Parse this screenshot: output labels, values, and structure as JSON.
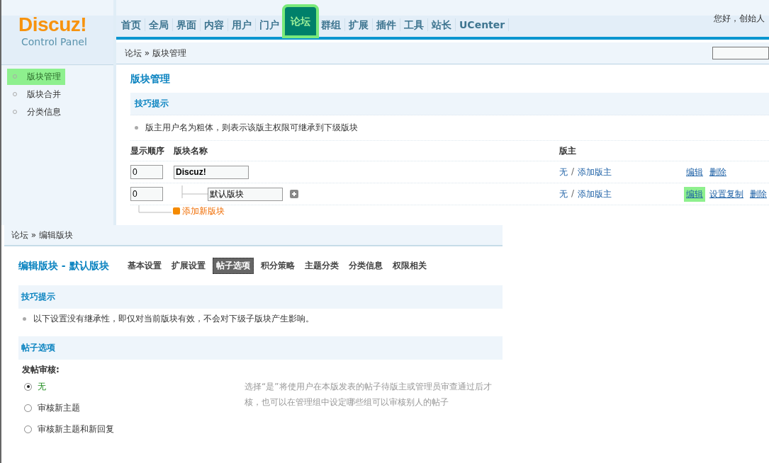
{
  "header": {
    "logo": "Discuz!",
    "subtitle": "Control Panel",
    "greeting": "您好，创始人"
  },
  "nav": [
    {
      "label": "首页",
      "selected": false
    },
    {
      "label": "全局",
      "selected": false
    },
    {
      "label": "界面",
      "selected": false
    },
    {
      "label": "内容",
      "selected": false
    },
    {
      "label": "用户",
      "selected": false
    },
    {
      "label": "门户",
      "selected": false
    },
    {
      "label": "论坛",
      "selected": true
    },
    {
      "label": "群组",
      "selected": false
    },
    {
      "label": "扩展",
      "selected": false
    },
    {
      "label": "插件",
      "selected": false
    },
    {
      "label": "工具",
      "selected": false
    },
    {
      "label": "站长",
      "selected": false
    },
    {
      "label": "UCenter",
      "selected": false
    }
  ],
  "breadcrumb": {
    "items": [
      "论坛",
      "版块管理"
    ],
    "separator": "»"
  },
  "sidebar": [
    {
      "label": "版块管理",
      "selected": true
    },
    {
      "label": "版块合并",
      "selected": false
    },
    {
      "label": "分类信息",
      "selected": false
    }
  ],
  "main": {
    "title": "版块管理",
    "tips": {
      "title": "技巧提示",
      "items": [
        "版主用户名为粗体，则表示该版主权限可继承到下级版块"
      ]
    },
    "table": {
      "columns": [
        "显示顺序",
        "版块名称",
        "版主"
      ],
      "link_separator": "/",
      "rows": [
        {
          "kind": "group",
          "order": "0",
          "name": "Discuz!",
          "moderator_links": [
            "无",
            "添加版主"
          ],
          "actions": [
            {
              "label": "编辑",
              "highlighted": false
            },
            {
              "label": "删除",
              "highlighted": false
            }
          ]
        },
        {
          "kind": "forum",
          "order": "0",
          "name": "默认版块",
          "moderator_links": [
            "无",
            "添加版主"
          ],
          "actions": [
            {
              "label": "编辑",
              "highlighted": true
            },
            {
              "label": "设置复制",
              "highlighted": false
            },
            {
              "label": "删除",
              "highlighted": false
            }
          ]
        }
      ],
      "add_forum": "添加新版块"
    }
  },
  "edit_window": {
    "breadcrumb": {
      "items": [
        "论坛",
        "编辑版块"
      ],
      "separator": "»"
    },
    "title": "编辑版块 - 默认版块",
    "tabs": [
      {
        "label": "基本设置",
        "selected": false
      },
      {
        "label": "扩展设置",
        "selected": false
      },
      {
        "label": "帖子选项",
        "selected": true
      },
      {
        "label": "积分策略",
        "selected": false
      },
      {
        "label": "主题分类",
        "selected": false
      },
      {
        "label": "分类信息",
        "selected": false
      },
      {
        "label": "权限相关",
        "selected": false
      }
    ],
    "tips": {
      "title": "技巧提示",
      "items": [
        "以下设置没有继承性，即仅对当前版块有效，不会对下级子版块产生影响。"
      ]
    },
    "section": "帖子选项",
    "field": {
      "label": "发帖审核:",
      "options": [
        {
          "label": "无",
          "selected": true
        },
        {
          "label": "审核新主题",
          "selected": false
        },
        {
          "label": "审核新主题和新回复",
          "selected": false
        }
      ],
      "help": "选择“是”将使用户在本版发表的帖子待版主或管理员审查通过后才核，也可以在管理组中设定哪些组可以审核别人的帖子"
    }
  }
}
